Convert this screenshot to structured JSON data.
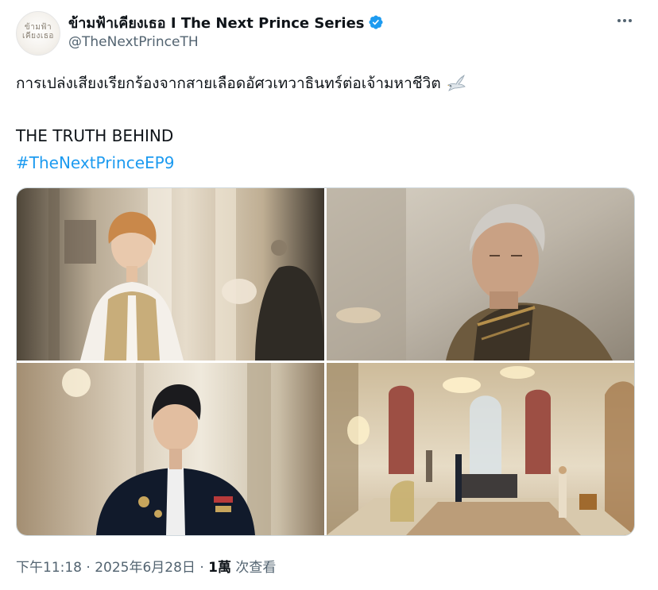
{
  "account": {
    "display_name": "ข้ามฟ้าเคียงเธอ I The Next Prince Series",
    "handle": "@TheNextPrinceTH",
    "avatar_text_line1": "ข้ามฟ้า",
    "avatar_text_line2": "เคียงเธอ",
    "verified_icon": "verified-badge-icon",
    "verified_color": "#1d9bf0"
  },
  "menu": {
    "more_icon": "more-horizontal-icon"
  },
  "post": {
    "thai_text": "การเปล่งเสียงเรียกร้องจากสายเลือดอัศวเทวาธินทร์ต่อเจ้ามหาชีวิต",
    "emoji_icon": "dove-icon",
    "english_text": "THE TRUTH BEHIND",
    "hashtag": "#TheNextPrinceEP9",
    "hashtag_color": "#1d9bf0"
  },
  "media": [
    {
      "name": "photo-prince-in-white-vest"
    },
    {
      "name": "photo-elder-in-gold-robe"
    },
    {
      "name": "photo-prince-in-navy-uniform"
    },
    {
      "name": "photo-throne-hall"
    }
  ],
  "meta": {
    "time": "下午11:18",
    "separator1": " · ",
    "date": "2025年6月28日",
    "separator2": " · ",
    "views_count": "1萬",
    "views_label": " 次查看"
  },
  "colors": {
    "text_primary": "#0f1419",
    "text_secondary": "#536471",
    "border": "#cfd9de"
  }
}
